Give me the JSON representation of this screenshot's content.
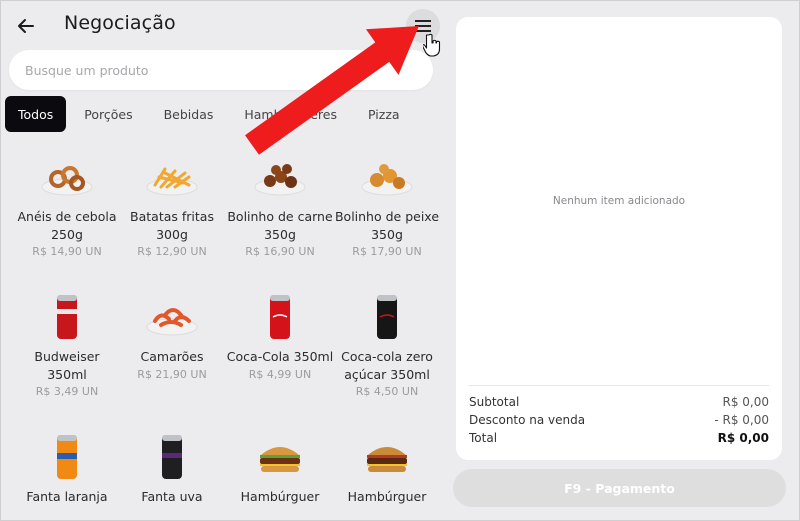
{
  "header": {
    "title": "Negociação",
    "back_icon": "arrow-left-icon",
    "menu_icon": "hamburger-menu-icon"
  },
  "search": {
    "placeholder": "Busque um produto",
    "value": ""
  },
  "tabs": [
    {
      "label": "Todos",
      "active": true
    },
    {
      "label": "Porções",
      "active": false
    },
    {
      "label": "Bebidas",
      "active": false
    },
    {
      "label": "Hambúrgueres",
      "active": false
    },
    {
      "label": "Pizza",
      "active": false
    }
  ],
  "products": [
    {
      "name": "Anéis de cebola 250g",
      "price": "R$ 14,90 UN",
      "image": "onion-rings-icon"
    },
    {
      "name": "Batatas fritas 300g",
      "price": "R$ 12,90 UN",
      "image": "fries-icon"
    },
    {
      "name": "Bolinho de carne 350g",
      "price": "R$ 16,90 UN",
      "image": "meatballs-icon"
    },
    {
      "name": "Bolinho de peixe 350g",
      "price": "R$ 17,90 UN",
      "image": "fishballs-icon"
    },
    {
      "name": "Budweiser 350ml",
      "price": "R$ 3,49 UN",
      "image": "red-can-icon"
    },
    {
      "name": "Camarões",
      "price": "R$ 21,90 UN",
      "image": "shrimp-icon"
    },
    {
      "name": "Coca-Cola 350ml",
      "price": "R$ 4,99 UN",
      "image": "coca-can-icon"
    },
    {
      "name": "Coca-cola zero açúcar 350ml",
      "price": "R$ 4,50 UN",
      "image": "black-can-icon"
    },
    {
      "name": "Fanta laranja",
      "price": "",
      "image": "orange-can-icon"
    },
    {
      "name": "Fanta uva",
      "price": "",
      "image": "grape-can-icon"
    },
    {
      "name": "Hambúrguer",
      "price": "",
      "image": "burger-icon"
    },
    {
      "name": "Hambúrguer",
      "price": "",
      "image": "burger-bacon-icon"
    }
  ],
  "cart": {
    "empty_message": "Nenhum item adicionado",
    "subtotal_label": "Subtotal",
    "subtotal_value": "R$ 0,00",
    "discount_label": "Desconto na venda",
    "discount_value": "- R$ 0,00",
    "total_label": "Total",
    "total_value": "R$ 0,00"
  },
  "payment_button": "F9 - Pagamento",
  "colors": {
    "accent_dark": "#0b0b0f",
    "arrow_red": "#ee1c1c",
    "background": "#ececee"
  }
}
